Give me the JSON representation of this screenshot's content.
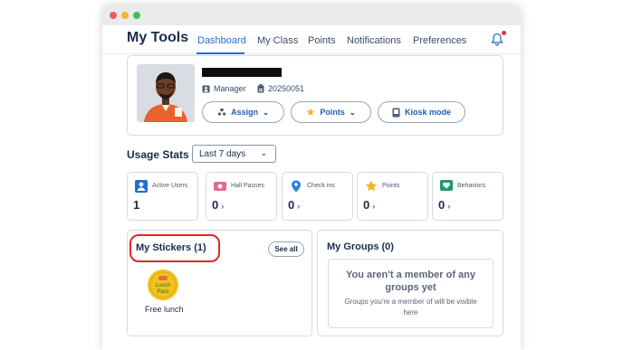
{
  "app": {
    "title": "My Tools"
  },
  "nav": {
    "tabs": [
      {
        "label": "Dashboard",
        "active": true
      },
      {
        "label": "My Class"
      },
      {
        "label": "Points"
      },
      {
        "label": "Notifications"
      },
      {
        "label": "Preferences"
      }
    ],
    "bell_icon": "bell-icon",
    "has_notification": true
  },
  "profile": {
    "role": "Manager",
    "id": "20250051",
    "name_redacted": true,
    "buttons": {
      "assign": "Assign",
      "points": "Points",
      "kiosk": "Kiosk mode"
    }
  },
  "usage": {
    "title": "Usage Stats",
    "range": "Last 7 days",
    "stats": [
      {
        "label": "Active Users",
        "value": "1",
        "icon": "user-icon",
        "color": "#1f6fd1",
        "has_arrow": false
      },
      {
        "label": "Hall Passes",
        "value": "0",
        "icon": "ticket-icon",
        "color": "#e86a8a",
        "has_arrow": true
      },
      {
        "label": "Check ins",
        "value": "0",
        "icon": "pin-icon",
        "color": "#2f7fe0",
        "has_arrow": true
      },
      {
        "label": "Points",
        "value": "0",
        "icon": "star-icon",
        "color": "#f4b532",
        "has_arrow": true
      },
      {
        "label": "Behaviors",
        "value": "0",
        "icon": "heart-icon",
        "color": "#1f9a6b",
        "has_arrow": true
      }
    ],
    "arrow": "›"
  },
  "stickers": {
    "title": "My Stickers (1)",
    "see_all": "See all",
    "items": [
      {
        "badge_text": "Lunch Pass",
        "caption": "Free lunch"
      }
    ]
  },
  "groups": {
    "title": "My Groups (0)",
    "empty_title": "You aren't a member of any groups yet",
    "empty_text": "Groups you're a member of will be visible here"
  },
  "colors": {
    "accent": "#1f6fd1",
    "highlight": "#d92b25"
  }
}
